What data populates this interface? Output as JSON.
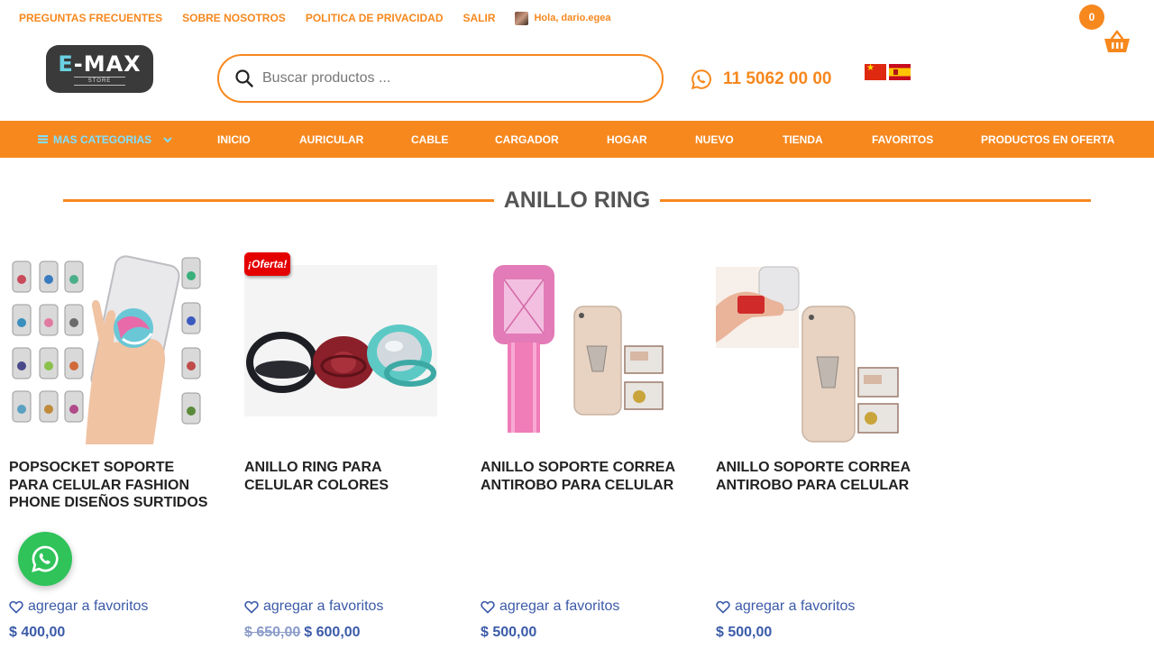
{
  "top_links": [
    {
      "label": "PREGUNTAS FRECUENTES"
    },
    {
      "label": "SOBRE NOSOTROS"
    },
    {
      "label": "POLITICA DE PRIVACIDAD"
    },
    {
      "label": "SALIR"
    }
  ],
  "user": {
    "greeting": "Hola, dario.egea"
  },
  "cart": {
    "count": "0",
    "icon": "basket-icon"
  },
  "logo": {
    "main_e": "E",
    "main_rest": "-MAX",
    "sub": "STORE"
  },
  "search": {
    "placeholder": "Buscar productos ...",
    "value": "",
    "icon": "search-icon"
  },
  "phone": {
    "number": "11 5062 00 00",
    "icon": "whatsapp-icon"
  },
  "flags": [
    "flag-china",
    "flag-spain"
  ],
  "nav": {
    "categories_label": "MAS CATEGORIAS",
    "items": [
      {
        "label": "INICIO"
      },
      {
        "label": "AURICULAR"
      },
      {
        "label": "CABLE"
      },
      {
        "label": "CARGADOR"
      },
      {
        "label": "HOGAR"
      },
      {
        "label": "NUEVO"
      },
      {
        "label": "TIENDA"
      },
      {
        "label": "FAVORITOS"
      },
      {
        "label": "PRODUCTOS EN OFERTA"
      }
    ]
  },
  "section": {
    "title": "ANILLO RING"
  },
  "products": [
    {
      "title": "POPSOCKET SOPORTE PARA CELULAR FASHION PHONE DISEÑOS SURTIDOS",
      "fav_label": "agregar a favoritos",
      "price": "$ 400,00",
      "old_price": "",
      "badge": ""
    },
    {
      "title": "ANILLO RING PARA CELULAR COLORES",
      "fav_label": "agregar a favoritos",
      "price": "$ 600,00",
      "old_price": "$ 650,00",
      "badge": "¡Oferta!"
    },
    {
      "title": "ANILLO SOPORTE CORREA ANTIROBO PARA CELULAR",
      "fav_label": "agregar a favoritos",
      "price": "$ 500,00",
      "old_price": "",
      "badge": ""
    },
    {
      "title": "ANILLO SOPORTE CORREA ANTIROBO PARA CELULAR",
      "fav_label": "agregar a favoritos",
      "price": "$ 500,00",
      "old_price": "",
      "badge": ""
    }
  ],
  "colors": {
    "accent": "#f7881e",
    "price": "#3b5aa8",
    "whatsapp": "#2fc35a",
    "sale_badge": "#e50000"
  }
}
